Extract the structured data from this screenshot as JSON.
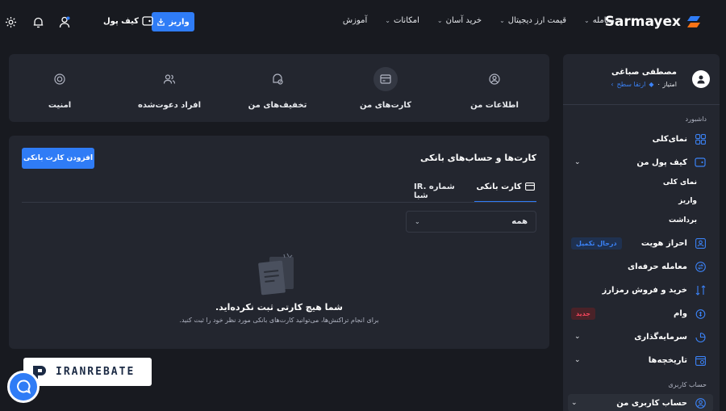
{
  "brand": {
    "name": "Sarmayex"
  },
  "nav": [
    {
      "label": "معامله"
    },
    {
      "label": "قیمت ارز دیجیتال"
    },
    {
      "label": "خرید آسان"
    },
    {
      "label": "امکانات"
    },
    {
      "label": "آموزش"
    }
  ],
  "header": {
    "deposit_label": "واریز",
    "wallet_label": "کیف پول"
  },
  "profile_tabs": [
    {
      "label": "اطلاعات من",
      "icon": "user-circle-icon"
    },
    {
      "label": "کارت‌های من",
      "icon": "card-icon",
      "active": true
    },
    {
      "label": "تخفیف‌های من",
      "icon": "discount-icon"
    },
    {
      "label": "افراد دعوت‌شده",
      "icon": "users-icon"
    },
    {
      "label": "امنیت",
      "icon": "shield-icon"
    }
  ],
  "bank": {
    "title": "کارت‌ها و حساب‌های بانکی",
    "add_label": "افزودن کارت بانکی",
    "tabs": [
      {
        "label": "کارت بانکی",
        "active": true
      },
      {
        "label": "IR. شماره شبا"
      }
    ],
    "filter_value": "همه",
    "empty_title": "شما هیچ کارتی ثبت نکرده‌اید.",
    "empty_sub": "برای انجام تراکنش‌ها، می‌توانید کارت‌های بانکی مورد نظر خود را ثبت کنید."
  },
  "user": {
    "name": "مصطفی صباغی",
    "score": "۰ امتیاز",
    "upgrade": "ارتقا سطح"
  },
  "sidebar": {
    "dashboard_label": "داشبورد",
    "items": [
      {
        "label": "نمای‌کلی"
      },
      {
        "label": "کیف پول من",
        "expandable": true
      },
      {
        "label": "احراز هویت",
        "badge": "درحال تکمیل"
      },
      {
        "label": "معامله حرفه‌ای"
      },
      {
        "label": "خرید و فروش رمزارز"
      },
      {
        "label": "وام",
        "badge": "جدید"
      },
      {
        "label": "سرمایه‌گذاری",
        "expandable": true
      },
      {
        "label": "تاریخچه‌ها",
        "expandable": true
      }
    ],
    "wallet_sub": [
      "نمای کلی",
      "واریز",
      "برداشت"
    ],
    "account_label": "حساب کاربری",
    "account_item": "حساب کاربری من"
  },
  "watermark": {
    "text": "IRANREBATE"
  },
  "colors": {
    "accent": "#2f7cf6",
    "bg": "#181a20",
    "card": "#23262f"
  }
}
